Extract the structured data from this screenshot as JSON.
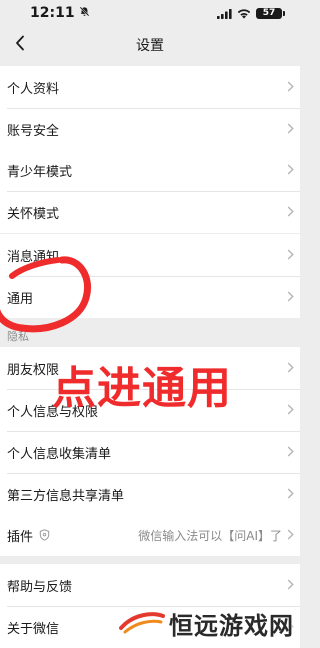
{
  "status_bar": {
    "time": "12:11",
    "battery": "57"
  },
  "nav": {
    "title": "设置"
  },
  "groups": [
    {
      "items": [
        {
          "label": "个人资料"
        },
        {
          "label": "账号安全"
        }
      ]
    },
    {
      "items": [
        {
          "label": "青少年模式"
        },
        {
          "label": "关怀模式"
        }
      ]
    },
    {
      "items": [
        {
          "label": "消息通知"
        },
        {
          "label": "通用"
        }
      ]
    },
    {
      "section_label": "隐私",
      "items": [
        {
          "label": "朋友权限"
        },
        {
          "label": "个人信息与权限"
        },
        {
          "label": "个人信息收集清单"
        },
        {
          "label": "第三方信息共享清单"
        }
      ]
    },
    {
      "items": [
        {
          "label": "插件",
          "detail": "微信输入法可以【问AI】了"
        }
      ]
    },
    {
      "items": [
        {
          "label": "帮助与反馈"
        },
        {
          "label": "关于微信"
        }
      ]
    }
  ],
  "annotation": {
    "text": "点进通用",
    "color": "#ef2b2b"
  },
  "watermark": {
    "text": "恒远游戏网"
  },
  "colors": {
    "background": "#ededed",
    "cell": "#ffffff",
    "annotation": "#ef2b2b"
  },
  "icons": {
    "back": "chevron-left-icon",
    "chevron": "chevron-right-icon",
    "plugin": "shield-icon"
  }
}
